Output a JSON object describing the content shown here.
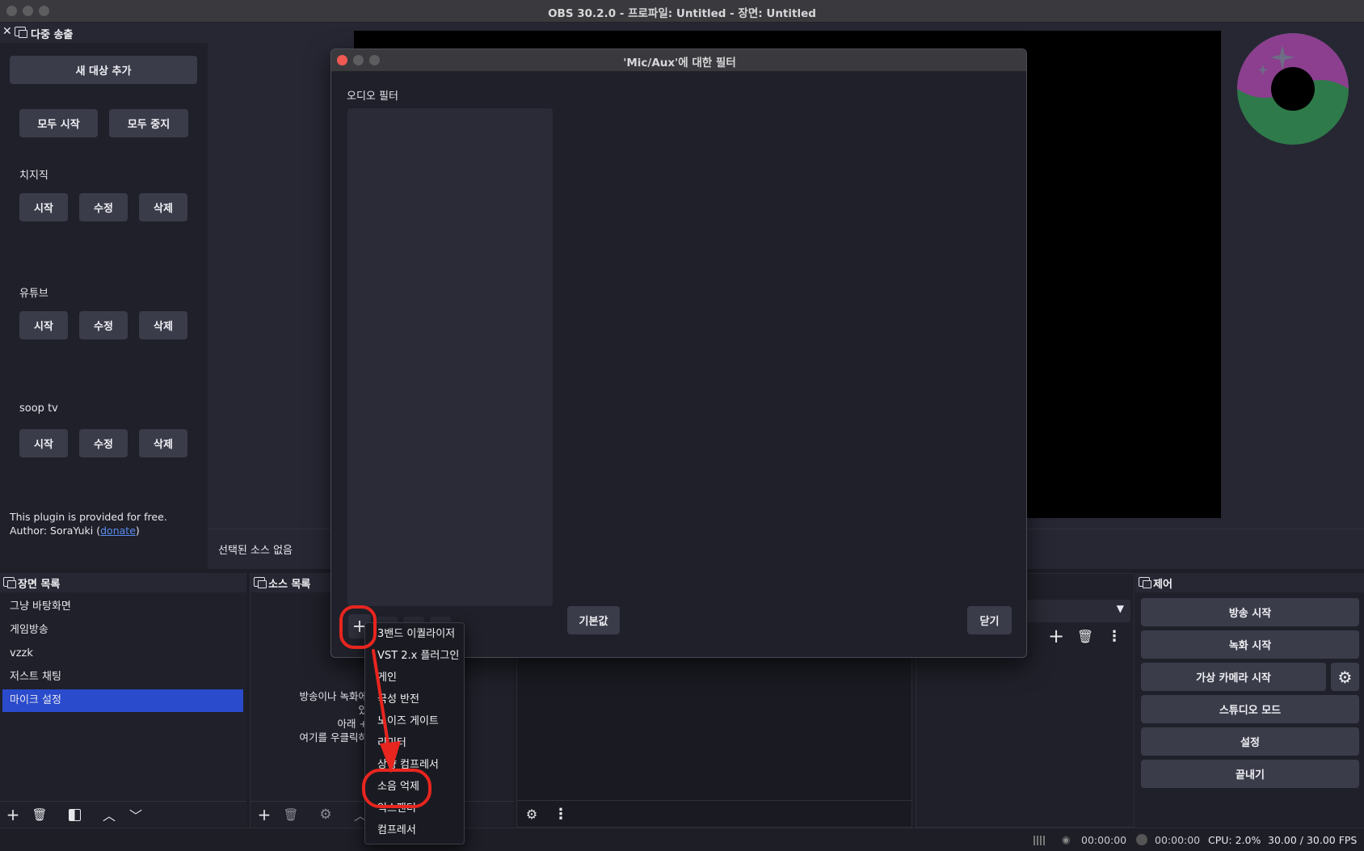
{
  "window": {
    "title": "OBS 30.2.0 - 프로파일: Untitled - 장면: Untitled"
  },
  "multistream": {
    "title": "다중 송출",
    "add_target_label": "새 대상 추가",
    "start_all_label": "모두 시작",
    "stop_all_label": "모두 중지",
    "targets": [
      {
        "name": "치지직",
        "start": "시작",
        "edit": "수정",
        "delete": "삭제"
      },
      {
        "name": "유튜브",
        "start": "시작",
        "edit": "수정",
        "delete": "삭제"
      },
      {
        "name": "soop tv",
        "start": "시작",
        "edit": "수정",
        "delete": "삭제"
      }
    ],
    "footer_line1": "This plugin is provided for free.",
    "footer_author": "Author: SoraYuki (",
    "footer_donate": "donate",
    "footer_close": ")"
  },
  "preview": {
    "no_source_label": "선택된 소스 없음"
  },
  "scenes": {
    "title": "장면 목록",
    "items": [
      "그냥 바탕화면",
      "게임방송",
      "vzzk",
      "저스트 채팅",
      "마이크 설정"
    ],
    "selected_index": 4
  },
  "sources": {
    "title": "소스 목록",
    "empty_lines": [
      "방송이나 녹화에",
      "있",
      "아래 +",
      "여기를 우클릭하"
    ]
  },
  "controls": {
    "title": "제어",
    "start_stream": "방송 시작",
    "start_record": "녹화 시작",
    "virtual_cam": "가상 카메라 시작",
    "studio_mode": "스튜디오 모드",
    "settings": "설정",
    "exit": "끝내기"
  },
  "filter_dialog": {
    "title": "'Mic/Aux'에 대한 필터",
    "section_label": "오디오 필터",
    "defaults_label": "기본값",
    "close_label": "닫기",
    "add_icon": "+"
  },
  "filter_menu": {
    "items": [
      "3밴드 이퀄라이저",
      "VST 2.x 플러그인",
      "게인",
      "극성 반전",
      "노이즈 게이트",
      "리미터",
      "상향 컴프레서",
      "소음 억제",
      "익스팬더",
      "컴프레서"
    ],
    "highlighted": "소음 억제"
  },
  "status": {
    "stream_time": "00:00:00",
    "record_time": "00:00:00",
    "cpu": "CPU: 2.0%",
    "fps": "30.00 / 30.00 FPS"
  },
  "colors": {
    "selection": "#2a4bcc",
    "annotation": "#e8251f",
    "link": "#5a8cf0",
    "window_bg": "#1d1e26"
  }
}
